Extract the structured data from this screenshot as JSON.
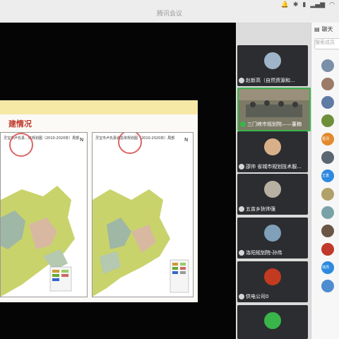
{
  "window": {
    "title": "腾讯会议"
  },
  "slide": {
    "heading": "建情况",
    "left_map_title": "灵宝市卢氏县…体规划图（2010-2020年）局部",
    "right_map_title": "灵宝市卢氏县城总体规划图（2010-2020年）局部"
  },
  "participants": [
    {
      "name": "赵新高（自然资源和..."
    },
    {
      "name": "三门峡市规划院——董楠"
    },
    {
      "name": "邵帅 省城市规划技术服..."
    },
    {
      "name": "五亩乡狄帅强"
    },
    {
      "name": "洛阳规划院-孙伟"
    },
    {
      "name": "供电公司0"
    }
  ],
  "chat": {
    "title": "聊天",
    "search_placeholder": "搜索成员"
  },
  "chat_avatars": [
    {
      "text": "",
      "color": "#7a8fa8"
    },
    {
      "text": "",
      "color": "#9b7b68"
    },
    {
      "text": "",
      "color": "#5f7aa3"
    },
    {
      "text": "",
      "color": "#6e8f3a"
    },
    {
      "text": "墨羽",
      "color": "#e28a2c"
    },
    {
      "text": "",
      "color": "#5c6670"
    },
    {
      "text": "王勇",
      "color": "#2d8ae0"
    },
    {
      "text": "",
      "color": "#b0a06a"
    },
    {
      "text": "",
      "color": "#79a1a8"
    },
    {
      "text": "",
      "color": "#6b5544"
    },
    {
      "text": "",
      "color": "#c0392b"
    },
    {
      "text": "境周",
      "color": "#2d8ae0"
    },
    {
      "text": "",
      "color": "#4f8ccf"
    }
  ]
}
